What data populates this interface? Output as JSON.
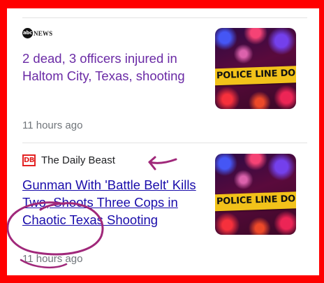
{
  "articles": [
    {
      "source": {
        "name": "NEWS",
        "logo_text": "abc",
        "icon": "abc-news-logo-icon"
      },
      "headline": "2 dead, 3 officers injured in Haltom City, Texas, shooting",
      "time": "11 hours ago",
      "thumbnail": {
        "icon": "police-tape-thumbnail",
        "tape_text": "POLICE LINE DO NOT CROSS"
      },
      "visited": true
    },
    {
      "source": {
        "name": "The Daily Beast",
        "logo_text": "DB",
        "icon": "daily-beast-logo-icon"
      },
      "headline": "Gunman With 'Battle Belt' Kills Two, Shoots Three Cops in Chaotic Texas Shooting",
      "time": "11 hours ago",
      "thumbnail": {
        "icon": "police-tape-thumbnail",
        "tape_text": "POLICE LINE DO NOT CROSS"
      },
      "visited": false
    }
  ],
  "colors": {
    "frame": "#ff0000",
    "visited_link": "#6a2aa5",
    "link": "#1a0dab",
    "annotation_ink": "#a0287a",
    "time_text": "#70757a"
  },
  "annotations": {
    "icon": "hand-drawn-arrow-and-circle"
  }
}
